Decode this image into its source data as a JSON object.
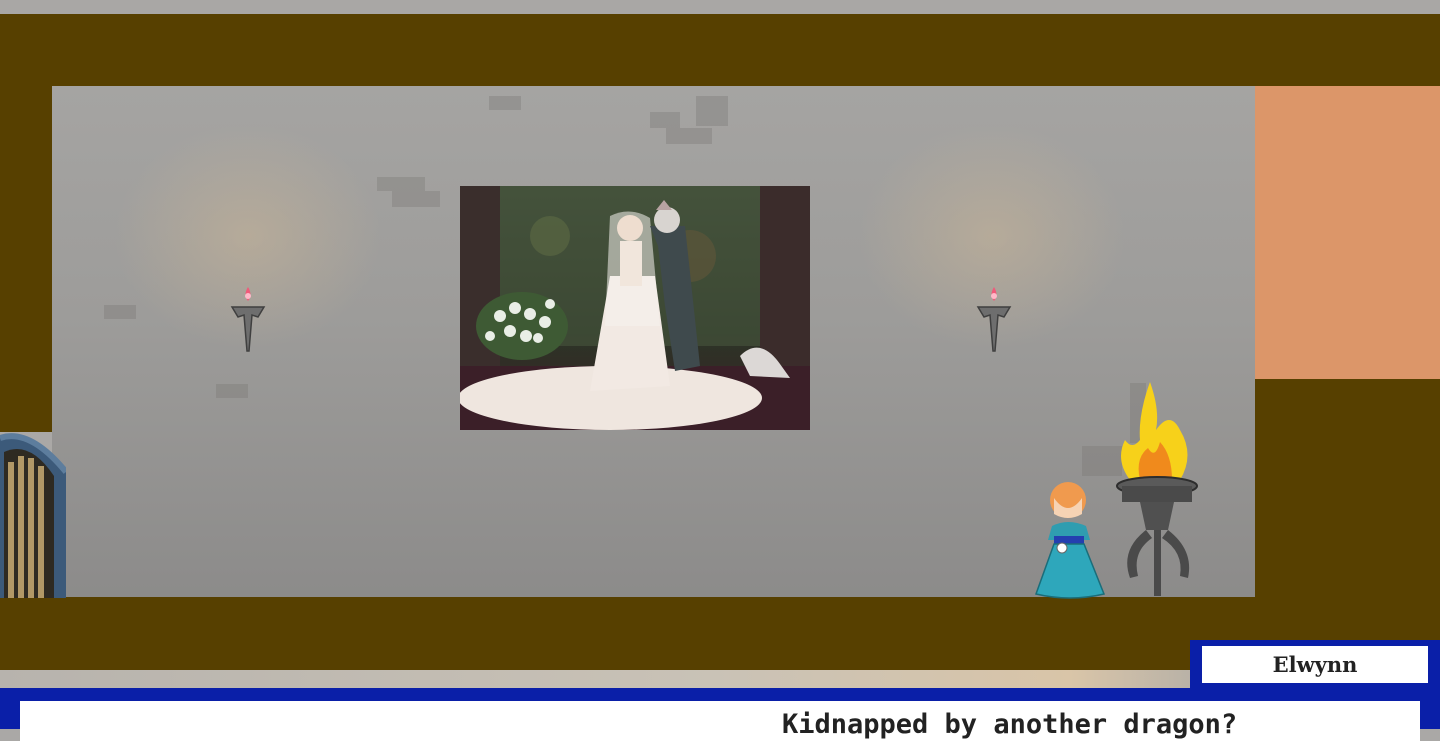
{
  "scene": {
    "speaker_name": "Elwynn",
    "dialog_line": "Kidnapped by another dragon?"
  },
  "colors": {
    "wall_brown": "#574000",
    "room_gray": "#9d9c9a",
    "orange_wall": "#dc9669",
    "dialog_blue": "#0a1fa8",
    "dialog_bg": "#ffffff"
  },
  "icons": [
    "wall-sconce-icon",
    "brazier-fire-icon",
    "princess-character",
    "arched-door",
    "wedding-painting"
  ]
}
